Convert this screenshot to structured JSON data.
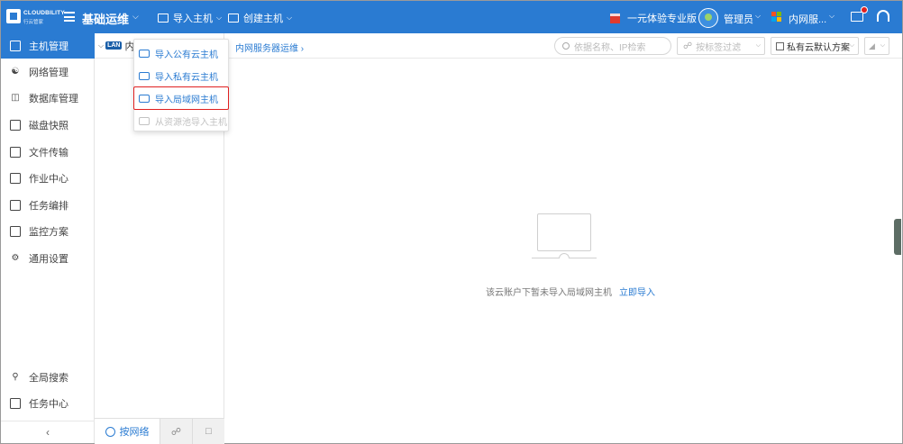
{
  "app": {
    "brand": "CLOUDBILITY",
    "brand_sub": "行云管家",
    "title": "基础运维"
  },
  "topmenu": {
    "import_host": "导入主机",
    "create_host": "创建主机",
    "trial": "一元体验专业版",
    "user": "管理员",
    "workspace": "内网服..."
  },
  "sidebar": {
    "items": [
      {
        "label": "主机管理",
        "icon": "monitor-icon"
      },
      {
        "label": "网络管理",
        "icon": "network-icon"
      },
      {
        "label": "数据库管理",
        "icon": "database-icon"
      },
      {
        "label": "磁盘快照",
        "icon": "disk-icon"
      },
      {
        "label": "文件传输",
        "icon": "file-transfer-icon"
      },
      {
        "label": "作业中心",
        "icon": "job-icon"
      },
      {
        "label": "任务编排",
        "icon": "task-icon"
      },
      {
        "label": "监控方案",
        "icon": "monitor-chart-icon"
      },
      {
        "label": "通用设置",
        "icon": "gear-icon"
      },
      {
        "label": "全局搜索",
        "icon": "search-icon"
      },
      {
        "label": "任务中心",
        "icon": "task-center-icon"
      }
    ]
  },
  "tree": {
    "lan_badge": "LAN",
    "head_label": "内网",
    "tab_network": "按网络"
  },
  "toolbar": {
    "breadcrumb": "内网服务器运维",
    "search_placeholder": "依据名称、IP检索",
    "tag_filter_placeholder": "按标签过滤",
    "plan": "私有云默认方案"
  },
  "empty": {
    "message": "该云账户下暂未导入局域网主机",
    "link": "立即导入"
  },
  "dropdown": {
    "items": [
      {
        "label": "导入公有云主机",
        "state": "normal"
      },
      {
        "label": "导入私有云主机",
        "state": "normal"
      },
      {
        "label": "导入局域网主机",
        "state": "highlighted"
      },
      {
        "label": "从资源池导入主机",
        "state": "disabled"
      }
    ]
  },
  "colors": {
    "primary": "#2a7bd2",
    "highlight_border": "#e02020"
  }
}
